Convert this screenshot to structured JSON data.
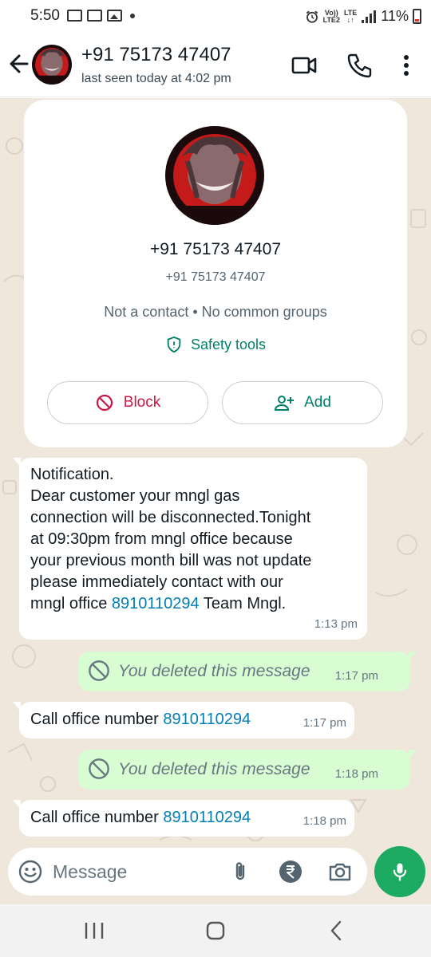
{
  "status_bar": {
    "time": "5:50",
    "network_top": "Vo))",
    "network_bottom": "LTE2",
    "lte_top": "LTE",
    "lte_bottom": "↓↑",
    "battery_pct": "11%"
  },
  "header": {
    "contact_name": "+91 75173 47407",
    "last_seen": "last seen today at 4:02 pm"
  },
  "profile_card": {
    "name": "+91 75173 47407",
    "phone": "+91 75173 47407",
    "info": "Not a contact • No common groups",
    "safety_tools": "Safety tools",
    "block_label": "Block",
    "add_label": "Add"
  },
  "messages": [
    {
      "direction": "in",
      "lines": [
        "Notification.",
        "Dear customer your mngl gas",
        "connection will be disconnected.Tonight",
        "at 09:30pm from mngl office because",
        "your previous month bill was not update",
        "please immediately contact with our"
      ],
      "last_line_prefix": "mngl office ",
      "link": "8910110294",
      "last_line_suffix": " Team Mngl.",
      "time": "1:13 pm"
    },
    {
      "direction": "out",
      "text": "You deleted this message",
      "time": "1:17 pm"
    },
    {
      "direction": "in",
      "prefix": "Call office number ",
      "link": "8910110294",
      "time": "1:17 pm"
    },
    {
      "direction": "out",
      "text": "You deleted this message",
      "time": "1:18 pm"
    },
    {
      "direction": "in",
      "prefix": "Call office number ",
      "link": "8910110294",
      "time": "1:18 pm"
    }
  ],
  "composer": {
    "placeholder": "Message"
  },
  "colors": {
    "accent_green": "#008069",
    "block_red": "#cc1744",
    "outgoing_bubble": "#d9fdd3",
    "mic_button": "#1daa61",
    "link": "#027eb5"
  }
}
